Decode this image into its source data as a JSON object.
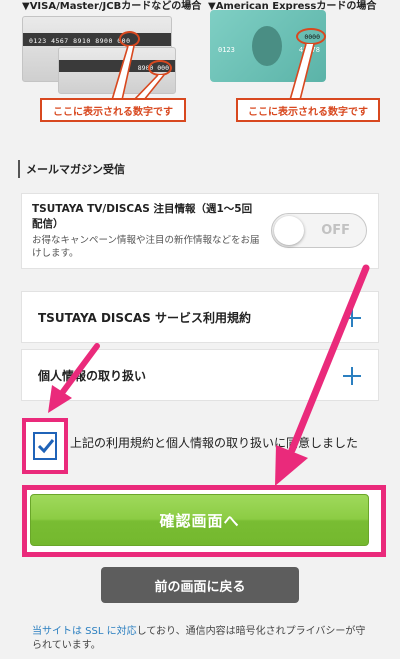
{
  "card_info": {
    "visa_caption": "▼VISA/Master/JCBカードなどの場合",
    "amex_caption": "▼American Expressカードの場合",
    "visa_card_number": "0123 4567 8910 8900 000",
    "visa_code": "8900 000",
    "amex_number_left": "0123",
    "amex_number_right": "45 78",
    "amex_code": "0000",
    "visa_callout": "ここに表示される数字です",
    "amex_callout": "ここに表示される数字です"
  },
  "mail_section": {
    "heading": "メールマガジン受信",
    "title": "TSUTAYA TV/DISCAS 注目情報（週1〜5回配信）",
    "description": "お得なキャンペーン情報や注目の新作情報などをお届けします。",
    "toggle_label": "OFF",
    "toggle_on": false
  },
  "accordion": {
    "terms_label": "TSUTAYA DISCAS サービス利用規約",
    "privacy_label": "個人情報の取り扱い"
  },
  "agreement": {
    "checked": true,
    "text": "上記の利用規約と個人情報の取り扱いに同意しました"
  },
  "buttons": {
    "confirm": "確認画面へ",
    "back": "前の画面に戻る"
  },
  "ssl": {
    "link_text": "当サイトは SSL に対応",
    "rest_text": "しており、通信内容は暗号化されプライバシーが守られています。"
  },
  "colors": {
    "highlight": "#ea2a7b",
    "accent_blue": "#2b7fc0",
    "confirm_green": "#8ccc44",
    "callout_red": "#d8481f"
  }
}
